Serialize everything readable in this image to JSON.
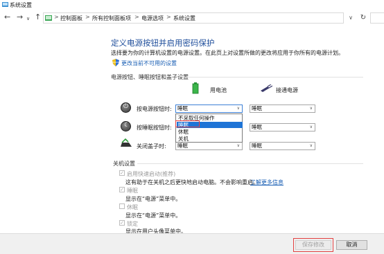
{
  "window": {
    "title": "系统设置"
  },
  "address": {
    "crumbs": [
      "控制面板",
      "所有控制面板项",
      "电源选项",
      "系统设置"
    ],
    "separator": ">"
  },
  "main": {
    "heading": "定义电源按钮并启用密码保护",
    "description": "选择要为你的计算机设置的电源设置。在此页上对设置所做的更改将应用于你所有的电源计划。",
    "change_unavailable_link": "更改当前不可用的设置"
  },
  "power_section": {
    "title": "电源按钮、睡眠按钮和盖子设置",
    "col_battery": "用电池",
    "col_plugged": "接通电源",
    "rows": [
      {
        "label": "按电源按钮时:",
        "battery": "睡眠",
        "plugged": "睡眠"
      },
      {
        "label": "按睡眠按钮时:",
        "battery": "睡眠",
        "plugged": "睡眠"
      },
      {
        "label": "关闭盖子时:",
        "battery": "睡眠",
        "plugged": "睡眠"
      }
    ],
    "dropdown_options": [
      "不采取任何操作",
      "睡眠",
      "休眠",
      "关机"
    ],
    "dropdown_selected": "睡眠"
  },
  "shutdown_section": {
    "title": "关机设置",
    "items": [
      {
        "label": "启用快速启动(推荐)",
        "checked": true,
        "desc": "这有助于在关机之后更快地启动电脑。不会影响重启。",
        "link": "了解更多信息"
      },
      {
        "label": "睡眠",
        "checked": true,
        "desc": "显示在“电源”菜单中。"
      },
      {
        "label": "休眠",
        "checked": false,
        "desc": "显示在“电源”菜单中。"
      },
      {
        "label": "锁定",
        "checked": true,
        "desc": "显示在用户头像菜单中。"
      }
    ]
  },
  "footer": {
    "save_label": "保存修改",
    "cancel_label": "取消"
  },
  "colors": {
    "heading": "#1f4e9b",
    "link": "#1a5fb4",
    "selection": "#1e74d6",
    "highlight_box": "#e34040"
  }
}
